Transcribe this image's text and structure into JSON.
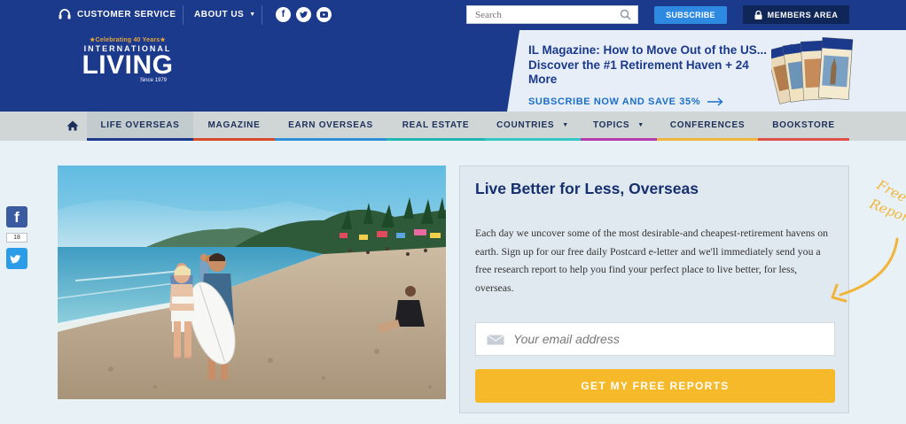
{
  "topbar": {
    "customer_service": "CUSTOMER SERVICE",
    "about_us": "ABOUT US",
    "about_caret": "▼",
    "social": [
      {
        "name": "facebook-icon",
        "glyph": "f"
      },
      {
        "name": "twitter-icon",
        "glyph": "t"
      },
      {
        "name": "youtube-icon",
        "glyph": "▶"
      }
    ],
    "search_placeholder": "Search",
    "subscribe": "SUBSCRIBE",
    "members_area": "MEMBERS AREA"
  },
  "logo": {
    "tagline": "★Celebrating 40 Years★",
    "line1": "INTERNATIONAL",
    "line2": "LIVING",
    "since": "Since 1979"
  },
  "promo": {
    "title": "IL Magazine: How to Move Out of the US... Discover the #1 Retirement Haven + 24 More",
    "cta": "SUBSCRIBE NOW AND SAVE 35%"
  },
  "nav": {
    "items": [
      {
        "label": "LIFE OVERSEAS",
        "color": "#1b3a8c",
        "active": true,
        "has_caret": false
      },
      {
        "label": "MAGAZINE",
        "color": "#d84a2c",
        "active": false,
        "has_caret": false
      },
      {
        "label": "EARN OVERSEAS",
        "color": "#2f8fd8",
        "active": false,
        "has_caret": false
      },
      {
        "label": "REAL ESTATE",
        "color": "#1fb7b0",
        "active": false,
        "has_caret": false
      },
      {
        "label": "COUNTRIES",
        "color": "#34c6c0",
        "active": false,
        "has_caret": true
      },
      {
        "label": "TOPICS",
        "color": "#b43cb0",
        "active": false,
        "has_caret": true
      },
      {
        "label": "CONFERENCES",
        "color": "#f0b53a",
        "active": false,
        "has_caret": false
      },
      {
        "label": "BOOKSTORE",
        "color": "#e0504a",
        "active": false,
        "has_caret": false
      }
    ],
    "caret": "▼"
  },
  "share": {
    "facebook_glyph": "f",
    "count": "18"
  },
  "signup": {
    "title": "Live Better for Less, Overseas",
    "body": "Each day we uncover some of the most desirable-and cheapest-retirement havens on earth. Sign up for our free daily Postcard e-letter and we'll immediately send you a free research report to help you find your perfect place to live better, for less, overseas.",
    "email_placeholder": "Your email address",
    "button": "GET MY FREE REPORTS"
  },
  "callout": {
    "line1": "Free",
    "line2": "Repor"
  },
  "colors": {
    "brand_blue": "#1b3a8c",
    "subscribe_blue": "#2d8ae0",
    "cta_yellow": "#f5b929",
    "accent_orange": "#e8a63b"
  }
}
